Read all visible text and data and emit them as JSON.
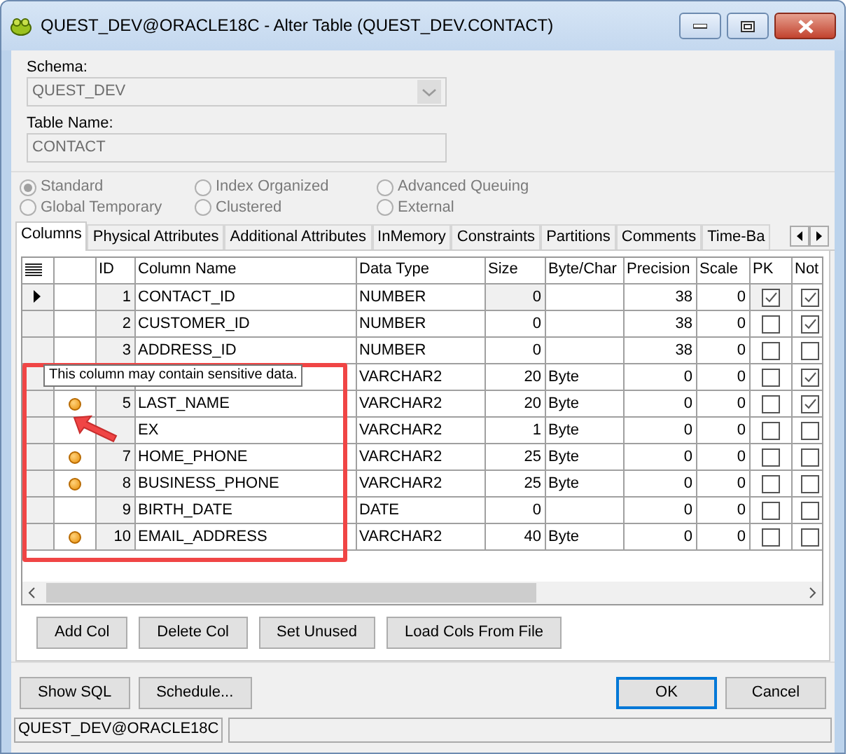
{
  "window": {
    "title": "QUEST_DEV@ORACLE18C - Alter Table (QUEST_DEV.CONTACT)"
  },
  "schema": {
    "label": "Schema:",
    "value": "QUEST_DEV",
    "disabled": true
  },
  "table_name": {
    "label": "Table Name:",
    "value": "CONTACT",
    "disabled": true
  },
  "table_types": [
    {
      "label": "Standard",
      "selected": true
    },
    {
      "label": "Index Organized",
      "selected": false
    },
    {
      "label": "Advanced Queuing",
      "selected": false
    },
    {
      "label": "Global Temporary",
      "selected": false
    },
    {
      "label": "Clustered",
      "selected": false
    },
    {
      "label": "External",
      "selected": false
    }
  ],
  "tabs": [
    {
      "label": "Columns",
      "selected": true
    },
    {
      "label": "Physical Attributes",
      "selected": false
    },
    {
      "label": "Additional Attributes",
      "selected": false
    },
    {
      "label": "InMemory",
      "selected": false
    },
    {
      "label": "Constraints",
      "selected": false
    },
    {
      "label": "Partitions",
      "selected": false
    },
    {
      "label": "Comments",
      "selected": false
    },
    {
      "label": "Time-Ba",
      "selected": false
    }
  ],
  "grid": {
    "columns": [
      "ID",
      "Column Name",
      "Data Type",
      "Size",
      "Byte/Char",
      "Precision",
      "Scale",
      "PK",
      "Not"
    ],
    "rows": [
      {
        "current": true,
        "sensitive": false,
        "id": "1",
        "name": "CONTACT_ID",
        "type": "NUMBER",
        "size": "0",
        "byte_char": "",
        "precision": "38",
        "scale": "0",
        "pk": true,
        "not_null": true
      },
      {
        "current": false,
        "sensitive": false,
        "id": "2",
        "name": "CUSTOMER_ID",
        "type": "NUMBER",
        "size": "0",
        "byte_char": "",
        "precision": "38",
        "scale": "0",
        "pk": false,
        "not_null": true
      },
      {
        "current": false,
        "sensitive": false,
        "id": "3",
        "name": "ADDRESS_ID",
        "type": "NUMBER",
        "size": "0",
        "byte_char": "",
        "precision": "38",
        "scale": "0",
        "pk": false,
        "not_null": false
      },
      {
        "current": false,
        "sensitive": false,
        "id": "",
        "name": "",
        "type": "VARCHAR2",
        "size": "20",
        "byte_char": "Byte",
        "precision": "0",
        "scale": "0",
        "pk": false,
        "not_null": true
      },
      {
        "current": false,
        "sensitive": true,
        "id": "5",
        "name": "LAST_NAME",
        "type": "VARCHAR2",
        "size": "20",
        "byte_char": "Byte",
        "precision": "0",
        "scale": "0",
        "pk": false,
        "not_null": true
      },
      {
        "current": false,
        "sensitive": false,
        "id": "",
        "name": "EX",
        "type": "VARCHAR2",
        "size": "1",
        "byte_char": "Byte",
        "precision": "0",
        "scale": "0",
        "pk": false,
        "not_null": false
      },
      {
        "current": false,
        "sensitive": true,
        "id": "7",
        "name": "HOME_PHONE",
        "type": "VARCHAR2",
        "size": "25",
        "byte_char": "Byte",
        "precision": "0",
        "scale": "0",
        "pk": false,
        "not_null": false
      },
      {
        "current": false,
        "sensitive": true,
        "id": "8",
        "name": "BUSINESS_PHONE",
        "type": "VARCHAR2",
        "size": "25",
        "byte_char": "Byte",
        "precision": "0",
        "scale": "0",
        "pk": false,
        "not_null": false
      },
      {
        "current": false,
        "sensitive": false,
        "id": "9",
        "name": "BIRTH_DATE",
        "type": "DATE",
        "size": "0",
        "byte_char": "",
        "precision": "0",
        "scale": "0",
        "pk": false,
        "not_null": false
      },
      {
        "current": false,
        "sensitive": true,
        "id": "10",
        "name": "EMAIL_ADDRESS",
        "type": "VARCHAR2",
        "size": "40",
        "byte_char": "Byte",
        "precision": "0",
        "scale": "0",
        "pk": false,
        "not_null": false
      }
    ]
  },
  "tooltip": "This column may contain sensitive data.",
  "grid_buttons": [
    "Add Col",
    "Delete Col",
    "Set Unused",
    "Load Cols From File"
  ],
  "footer_buttons": [
    {
      "label": "Show SQL",
      "default": false
    },
    {
      "label": "Schedule...",
      "default": false
    },
    {
      "label": "OK",
      "default": true
    },
    {
      "label": "Cancel",
      "default": false
    }
  ],
  "status_bar": "QUEST_DEV@ORACLE18C"
}
